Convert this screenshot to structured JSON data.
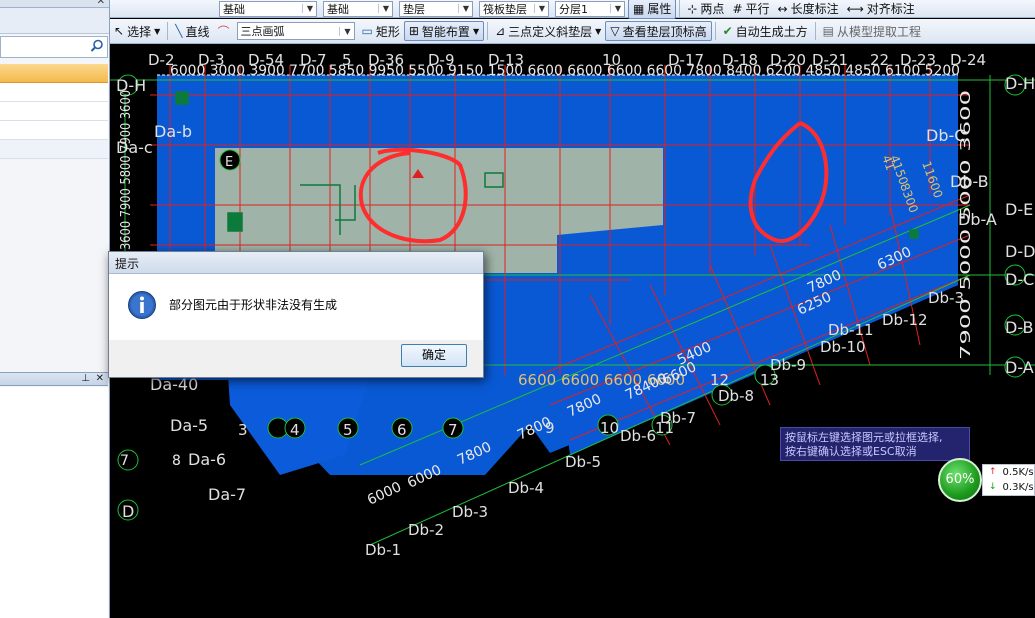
{
  "toolbar_top": {
    "combo1": "基础",
    "combo2": "基础",
    "combo3": "垫层",
    "combo4": "筏板垫层",
    "combo5": "分层1",
    "props_label": "属性",
    "two_point": "两点",
    "parallel": "平行",
    "length_dim": "长度标注",
    "align_dim": "对齐标注"
  },
  "toolbar_draw": {
    "select": "选择",
    "line": "直线",
    "arc_combo": "三点画弧",
    "rect": "矩形",
    "smart_layout": "智能布置",
    "slope_layer": "三点定义斜垫层",
    "view_top_elev": "查看垫层顶标高",
    "auto_earthwork": "自动生成土方",
    "extract_from_model": "从模型提取工程"
  },
  "dialog": {
    "title": "提示",
    "message": "部分图元由于形状非法没有生成",
    "ok": "确定"
  },
  "hint": {
    "line1": "按鼠标左键选择图元或拉框选择,",
    "line2": "按右键确认选择或ESC取消"
  },
  "network": {
    "percent": "60%",
    "up": "0.5K/s",
    "down": "0.3K/s"
  },
  "axis_labels": {
    "top": [
      "D-2",
      "D-3",
      "D-54",
      "D-7",
      "5",
      "D-36",
      "D-9",
      "D-13",
      "10",
      "D-17",
      "D-18",
      "D-20",
      "D-21",
      "22",
      "D-23",
      "D-24"
    ],
    "top_dims": "6000 3000 3900 7700 5850 9950 5500 9150 1500 6600 6600 6600 6600 7800 8400 6200 4850 4850 6100 5200",
    "right": [
      "D-H",
      "Db-C",
      "Db-B",
      "Db-A",
      "D-D",
      "D-C",
      "D-B",
      "D-A",
      "D-E"
    ],
    "left": [
      "D-H",
      "Da-b",
      "Da-c",
      "E",
      "Da-40",
      "Da-5",
      "Da-6",
      "Da-7",
      "D"
    ],
    "bottom_nums": [
      "3",
      "4",
      "5",
      "6",
      "7",
      "9",
      "10",
      "11",
      "12",
      "13"
    ],
    "bottom_dims": "6600 6600 6600 6600",
    "diag_dims": [
      "7800",
      "6300",
      "6250",
      "6000",
      "6000",
      "7800",
      "7800",
      "7800",
      "78400",
      "5400",
      "6600"
    ],
    "db_labels": [
      "Db-1",
      "Db-2",
      "Db-3",
      "Db-4",
      "Db-5",
      "Db-6",
      "Db-7",
      "Db-8",
      "Db-9",
      "Db-10",
      "Db-11",
      "Db-12",
      "Db-3"
    ],
    "left_dims": "3600 7900 5800 7900 3600",
    "right_dims": "7900 5000 5000 3600",
    "misc": [
      "7",
      "8",
      "4150",
      "11600",
      "41",
      "8300",
      "1",
      "2"
    ]
  }
}
